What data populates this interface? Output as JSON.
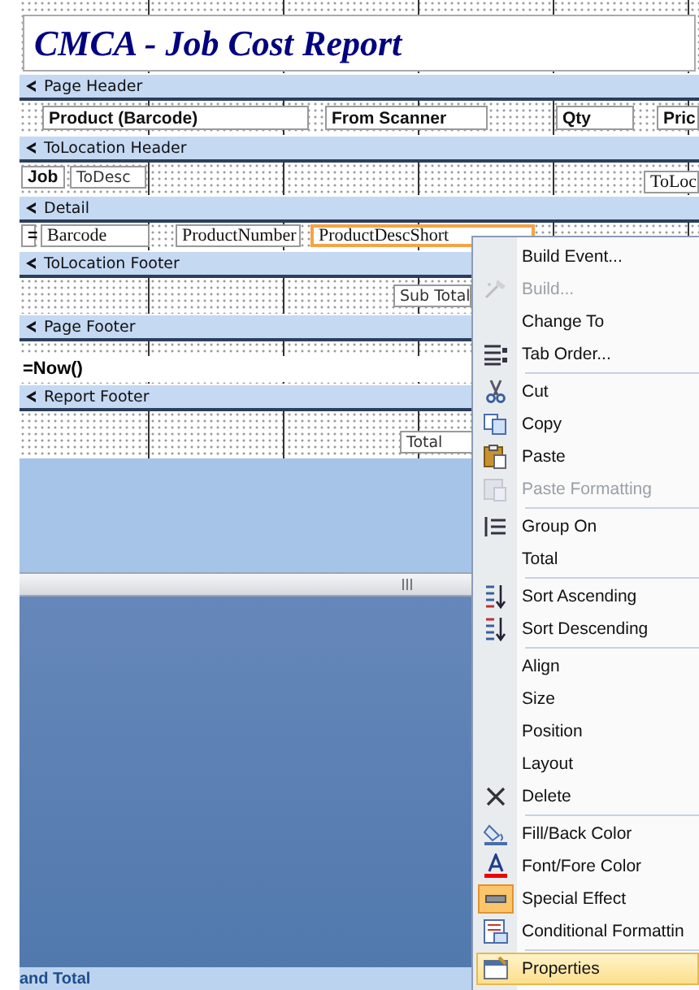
{
  "report_title": "CMCA - Job Cost Report",
  "sections": [
    {
      "title": "Page Header",
      "controls": [
        {
          "text": "Product (Barcode)",
          "kind": "label",
          "selected": false
        },
        {
          "text": "From Scanner",
          "kind": "label",
          "selected": false
        },
        {
          "text": "Qty",
          "kind": "label",
          "selected": false
        },
        {
          "text": "Pric",
          "kind": "label",
          "selected": false
        }
      ]
    },
    {
      "title": "ToLocation Header",
      "controls": [
        {
          "text": "Job",
          "kind": "label",
          "selected": false
        },
        {
          "text": "ToDesc",
          "kind": "text",
          "selected": false
        },
        {
          "text": "ToLoc",
          "kind": "field",
          "selected": false
        }
      ]
    },
    {
      "title": "Detail",
      "controls": [
        {
          "text": "=",
          "kind": "label",
          "selected": false
        },
        {
          "text": "Barcode",
          "kind": "field",
          "selected": false
        },
        {
          "text": "ProductNumber",
          "kind": "field",
          "selected": false
        },
        {
          "text": "ProductDescShort",
          "kind": "field",
          "selected": true
        }
      ]
    },
    {
      "title": "ToLocation Footer",
      "controls": [
        {
          "text": "Sub Total",
          "kind": "text",
          "selected": false
        }
      ]
    },
    {
      "title": "Page Footer",
      "controls": [
        {
          "text": "=Now()",
          "kind": "expression",
          "selected": false
        }
      ]
    },
    {
      "title": "Report Footer",
      "controls": [
        {
          "text": "Total",
          "kind": "text",
          "selected": false
        }
      ]
    }
  ],
  "status_bar": "and Total",
  "context_menu": [
    {
      "label": "Build Event...",
      "disabled": false,
      "selected": false,
      "checked": false,
      "separator_after": false
    },
    {
      "label": "Build...",
      "disabled": true,
      "selected": false,
      "checked": false,
      "separator_after": false
    },
    {
      "label": "Change To",
      "disabled": false,
      "selected": false,
      "checked": false,
      "separator_after": false
    },
    {
      "label": "Tab Order...",
      "disabled": false,
      "selected": false,
      "checked": false,
      "separator_after": true
    },
    {
      "label": "Cut",
      "disabled": false,
      "selected": false,
      "checked": false,
      "separator_after": false
    },
    {
      "label": "Copy",
      "disabled": false,
      "selected": false,
      "checked": false,
      "separator_after": false
    },
    {
      "label": "Paste",
      "disabled": false,
      "selected": false,
      "checked": false,
      "separator_after": false
    },
    {
      "label": "Paste Formatting",
      "disabled": true,
      "selected": false,
      "checked": false,
      "separator_after": true
    },
    {
      "label": "Group On",
      "disabled": false,
      "selected": false,
      "checked": false,
      "separator_after": false
    },
    {
      "label": "Total",
      "disabled": false,
      "selected": false,
      "checked": false,
      "separator_after": true
    },
    {
      "label": "Sort Ascending",
      "disabled": false,
      "selected": false,
      "checked": false,
      "separator_after": false
    },
    {
      "label": "Sort Descending",
      "disabled": false,
      "selected": false,
      "checked": false,
      "separator_after": true
    },
    {
      "label": "Align",
      "disabled": false,
      "selected": false,
      "checked": false,
      "separator_after": false
    },
    {
      "label": "Size",
      "disabled": false,
      "selected": false,
      "checked": false,
      "separator_after": false
    },
    {
      "label": "Position",
      "disabled": false,
      "selected": false,
      "checked": false,
      "separator_after": false
    },
    {
      "label": "Layout",
      "disabled": false,
      "selected": false,
      "checked": false,
      "separator_after": false
    },
    {
      "label": "Delete",
      "disabled": false,
      "selected": false,
      "checked": false,
      "separator_after": true
    },
    {
      "label": "Fill/Back Color",
      "disabled": false,
      "selected": false,
      "checked": false,
      "separator_after": false
    },
    {
      "label": "Font/Fore Color",
      "disabled": false,
      "selected": false,
      "checked": false,
      "separator_after": false
    },
    {
      "label": "Special Effect",
      "disabled": false,
      "selected": false,
      "checked": true,
      "separator_after": false
    },
    {
      "label": "Conditional Formattin",
      "disabled": false,
      "selected": false,
      "checked": false,
      "separator_after": true
    },
    {
      "label": "Properties",
      "disabled": false,
      "selected": true,
      "checked": false,
      "separator_after": false
    }
  ]
}
